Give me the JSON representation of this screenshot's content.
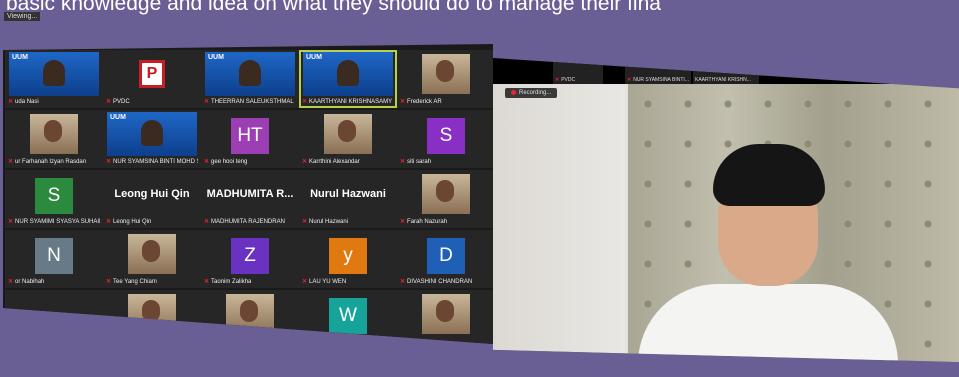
{
  "banner": {
    "text": "basic knowledge and idea on what they should do to manage their fina"
  },
  "recording_badge": "Viewing...",
  "gallery": {
    "tiles": [
      {
        "name": "uda Nasi",
        "kind": "slide"
      },
      {
        "name": "PVDC",
        "kind": "pvdc",
        "glyph": "P"
      },
      {
        "name": "THEERRAN SALEUKSTHMAL",
        "kind": "slide"
      },
      {
        "name": "KAARTHYANI KRISHNASAMY",
        "kind": "slide",
        "speaking": true
      },
      {
        "name": "Frederick AR",
        "kind": "photo"
      },
      {
        "name": "ur Farhanah Izyan Rasdan",
        "kind": "photo"
      },
      {
        "name": "NUR SYAMSINA BINTI MOHD SI",
        "kind": "slide"
      },
      {
        "name": "gee hooi teng",
        "kind": "avatar",
        "initials": "HT",
        "color": "#9c3fb5"
      },
      {
        "name": "Karrthini Alexandar",
        "kind": "photo"
      },
      {
        "name": "siti sarah",
        "kind": "avatar",
        "initials": "S",
        "color": "#8a2fc6"
      },
      {
        "name": "NUR SYAMIMI SYASYA SUHAIMI",
        "kind": "avatar",
        "initials": "S",
        "color": "#2b8a3e"
      },
      {
        "name": "Leong Hui Qin",
        "kind": "text",
        "display": "Leong Hui Qin"
      },
      {
        "name": "MADHUMITA RAJENDRAN",
        "kind": "text",
        "display": "MADHUMITA R..."
      },
      {
        "name": "Nurul Hazwani",
        "kind": "text",
        "display": "Nurul Hazwani"
      },
      {
        "name": "Farah Nazurah",
        "kind": "photo"
      },
      {
        "name": "or Nabihah",
        "kind": "avatar",
        "initials": "N",
        "color": "#667a87"
      },
      {
        "name": "Tee Yang Chiam",
        "kind": "photo"
      },
      {
        "name": "Taonim Zalikha",
        "kind": "avatar",
        "initials": "Z",
        "color": "#6a32c0"
      },
      {
        "name": "LAU YU WEN",
        "kind": "avatar",
        "initials": "y",
        "color": "#e07a10"
      },
      {
        "name": "DIVASHINI CHANDRAN",
        "kind": "avatar",
        "initials": "D",
        "color": "#1f5fb5"
      },
      {
        "name": "",
        "kind": "blank"
      },
      {
        "name": "",
        "kind": "photo"
      },
      {
        "name": "",
        "kind": "photo"
      },
      {
        "name": "",
        "kind": "avatar",
        "initials": "W",
        "color": "#16a39a"
      },
      {
        "name": "",
        "kind": "photo"
      }
    ]
  },
  "speaker": {
    "thumbs": [
      {
        "name": "PVDC"
      },
      {
        "name": "NUR SYAMSINA BINTI..."
      },
      {
        "name": "KAARTHYANI KRISHN..."
      }
    ],
    "recording": "Recording..."
  }
}
